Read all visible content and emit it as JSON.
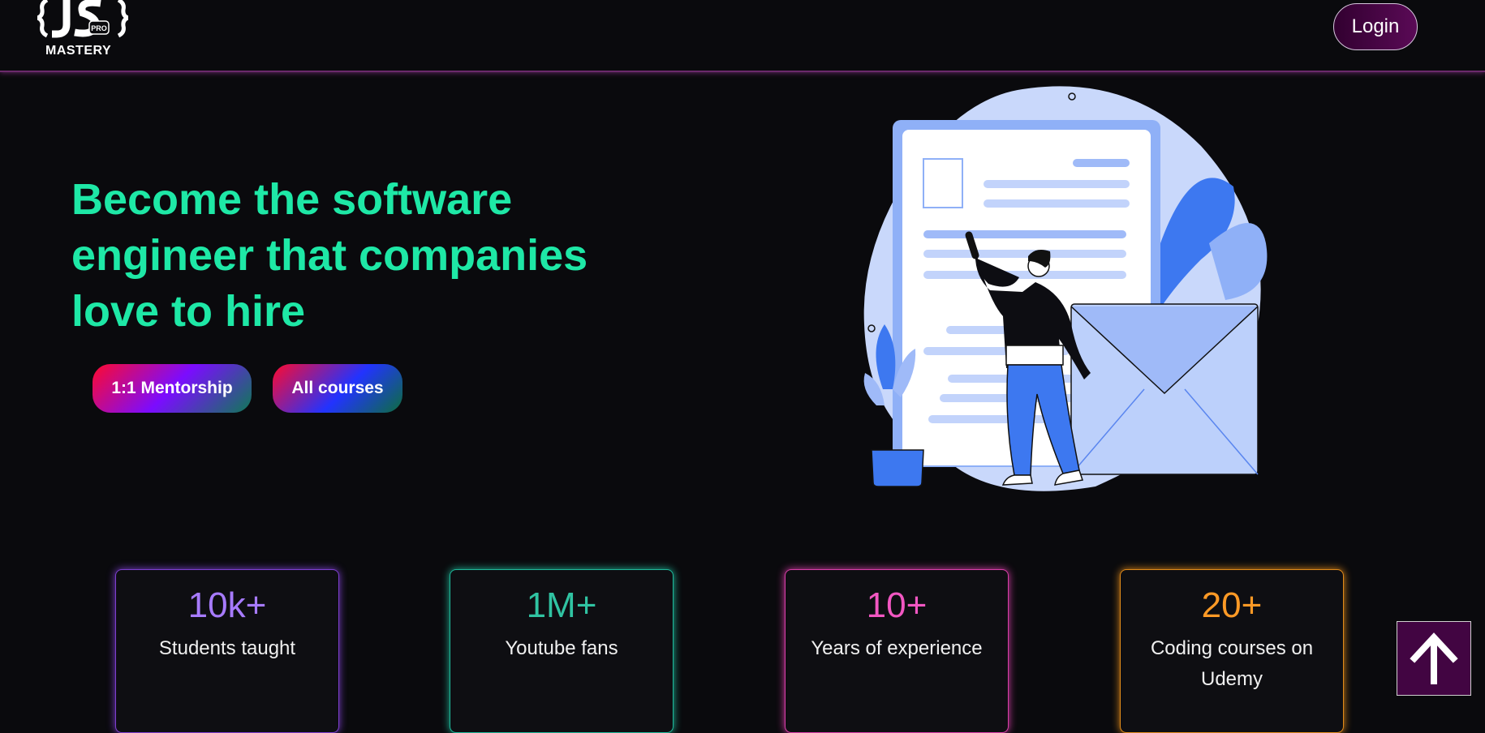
{
  "nav": {
    "logo_badge": "PRO",
    "logo_text": "MASTERY",
    "login_label": "Login"
  },
  "hero": {
    "title": "Become the software engineer that companies love to hire",
    "buttons": [
      {
        "label": "1:1 Mentorship"
      },
      {
        "label": "All courses"
      }
    ],
    "illustration": "man-pointing-at-document-with-envelope-illustration"
  },
  "stats": [
    {
      "value": "10k+",
      "label": "Students taught",
      "color": "#a77bff"
    },
    {
      "value": "1M+",
      "label": "Youtube fans",
      "color": "#30c3a2"
    },
    {
      "value": "10+",
      "label": "Years of experience",
      "color": "#f257c2"
    },
    {
      "value": "20+",
      "label": "Coding courses on Udemy",
      "color": "#ff9a26"
    }
  ],
  "colors": {
    "background": "#0a0a0d",
    "hero_title": "#1ee8a6",
    "nav_border": "#6b2a6b",
    "scroll_button": "#420542"
  },
  "icons": {
    "scroll_top": "arrow-up-icon"
  }
}
